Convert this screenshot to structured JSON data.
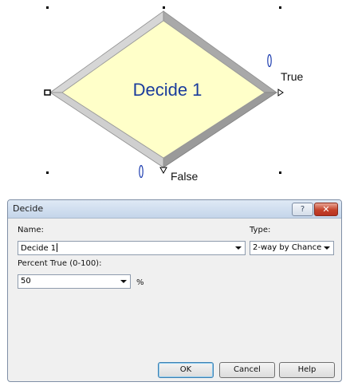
{
  "module": {
    "title": "Decide 1",
    "true_label": "True",
    "false_label": "False",
    "colors": {
      "fill": "#ffffc9",
      "title": "#1a3c9c",
      "bevel_light": "#d8d8d8",
      "bevel_dark": "#9a9a9a",
      "connector": "#1f3fb0"
    }
  },
  "dialog": {
    "title": "Decide",
    "help_icon": "?",
    "close_icon": "✕",
    "name_label": "Name:",
    "name_value": "Decide 1",
    "type_label": "Type:",
    "type_value": "2-way by Chance",
    "percent_label": "Percent True (0-100):",
    "percent_value": "50",
    "percent_unit": "%",
    "buttons": {
      "ok": "OK",
      "cancel": "Cancel",
      "help": "Help"
    }
  }
}
